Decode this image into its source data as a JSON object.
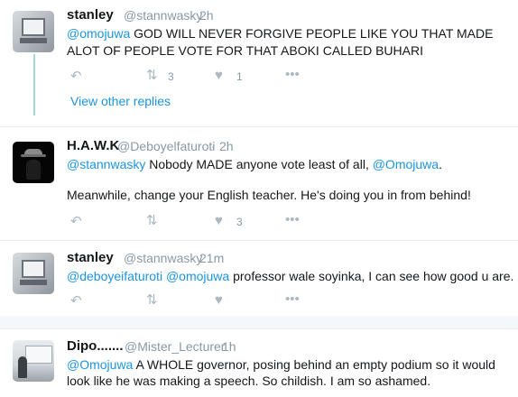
{
  "tweets": [
    {
      "name": "stanley",
      "handle": "@stannwasky",
      "time": "2h",
      "mention1": "@omojuwa",
      "text1": " GOD WILL NEVER FORGIVE PEOPLE LIKE YOU THAT MADE",
      "text2": "ALOT OF PEOPLE VOTE FOR THAT ABOKI CALLED BUHARI",
      "retweets": "3",
      "likes": "1"
    },
    {
      "name": "H.A.W.K",
      "handle": "@Deboyelfaturoti",
      "time": "2h",
      "mention1": "@stannwasky",
      "text1": " Nobody MADE anyone vote least of all, ",
      "mention2": "@Omojuwa",
      "text1_end": ".",
      "text2": "Meanwhile, change your English teacher. He's doing you in from behind!",
      "likes": "3"
    },
    {
      "name": "stanley",
      "handle": "@stannwasky",
      "time": "21m",
      "mention1": "@deboyeifaturoti",
      "mention2": "@omojuwa",
      "text1": " professor wale soyinka, I can see how good u are."
    },
    {
      "name": "Dipo.......",
      "handle": "@Mister_Lecturer",
      "time": "1h",
      "mention1": "@Omojuwa",
      "text1": " A WHOLE governor, posing behind an empty podium so it would",
      "text2": "look like he was making a speech. So childish. I am so ashamed."
    }
  ],
  "view_other_replies": "View other replies",
  "separator": "·",
  "icons": {
    "reply": "reply-icon",
    "retweet": "retweet-icon",
    "like": "heart-icon",
    "more": "more-icon"
  },
  "colors": {
    "link": "#1b95e0",
    "thread_line": "#a6dcc6",
    "icon": "#aab8c2"
  }
}
